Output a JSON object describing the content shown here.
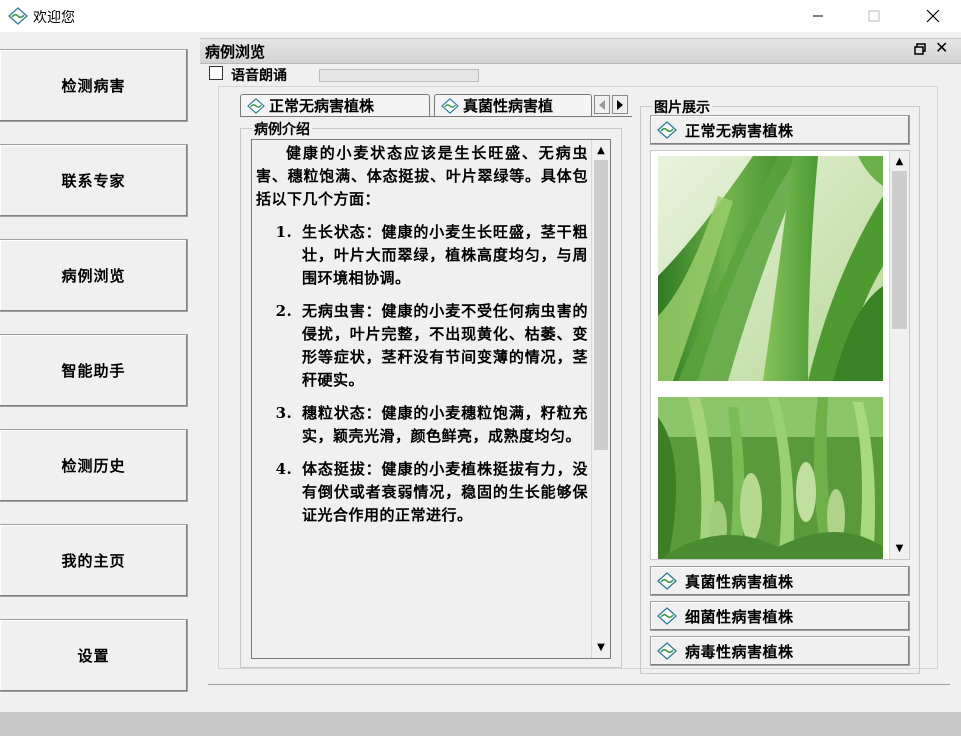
{
  "window": {
    "title": "欢迎您",
    "controls": [
      "minimize",
      "maximize",
      "close"
    ]
  },
  "nav": {
    "items": [
      {
        "label": "检测病害"
      },
      {
        "label": "联系专家"
      },
      {
        "label": "病例浏览"
      },
      {
        "label": "智能助手"
      },
      {
        "label": "检测历史"
      },
      {
        "label": "我的主页"
      },
      {
        "label": "设置"
      }
    ]
  },
  "panel": {
    "title": "病例浏览",
    "tts_label": "语音朗诵",
    "tts_checked": false,
    "tabs": [
      {
        "label": "正常无病害植株",
        "active": true
      },
      {
        "label": "真菌性病害植"
      }
    ],
    "intro_legend": "病例介绍",
    "intro": {
      "paragraph": "健康的小麦状态应该是生长旺盛、无病虫害、穗粒饱满、体态挺拔、叶片翠绿等。具体包括以下几个方面：",
      "items": [
        "生长状态：健康的小麦生长旺盛，茎干粗壮，叶片大而翠绿，植株高度均匀，与周围环境相协调。",
        "无病虫害：健康的小麦不受任何病虫害的侵扰，叶片完整，不出现黄化、枯萎、变形等症状，茎秆没有节间变薄的情况，茎秆硬实。",
        "穗粒状态：健康的小麦穗粒饱满，籽粒充实，颖壳光滑，颜色鲜亮，成熟度均匀。",
        "体态挺拔：健康的小麦植株挺拔有力，没有倒伏或者衰弱情况，稳固的生长能够保证光合作用的正常进行。"
      ]
    },
    "gallery_legend": "图片展示",
    "categories": [
      {
        "label": "正常无病害植株"
      },
      {
        "label": "真菌性病害植株"
      },
      {
        "label": "细菌性病害植株"
      },
      {
        "label": "病毒性病害植株"
      }
    ]
  },
  "colors": {
    "background": "#f0f0f0",
    "leaf_dark": "#3f8a2a",
    "leaf_light": "#9ccf6e",
    "icon_green": "#3a9a4a"
  }
}
